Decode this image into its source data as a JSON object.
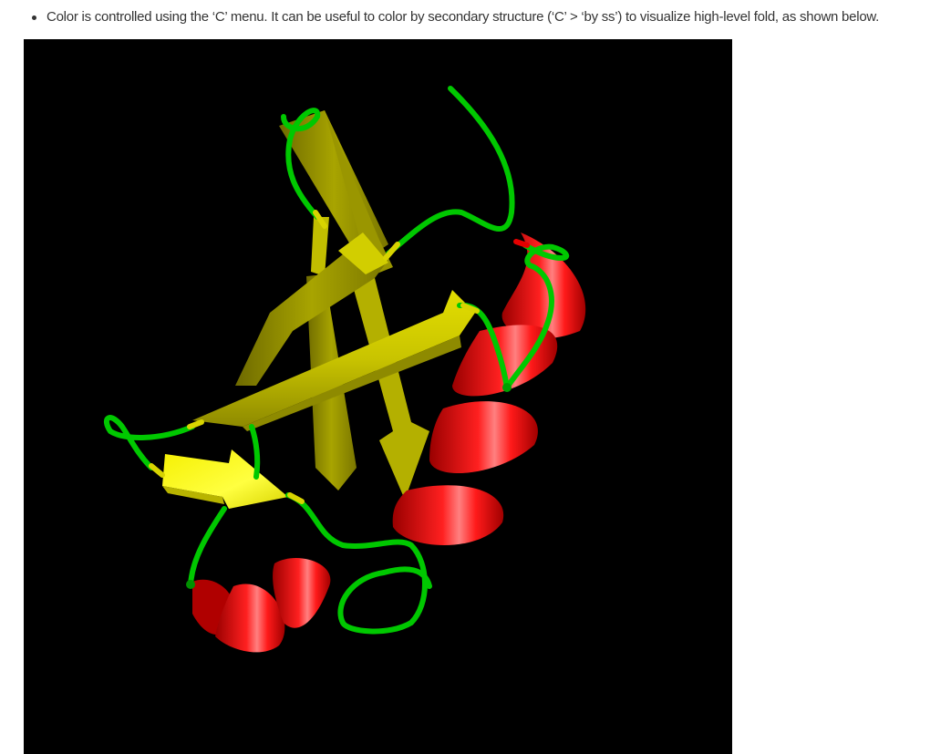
{
  "bullet": {
    "text": "Color is controlled using the ‘C’ menu. It can be useful to color by secondary structure (‘C’ > ‘by ss’) to visualize high-level fold, as shown below."
  },
  "figure": {
    "background": "#000000",
    "colors": {
      "helix": "#e60000",
      "sheet": "#c8c800",
      "loop": "#00cc00"
    }
  }
}
